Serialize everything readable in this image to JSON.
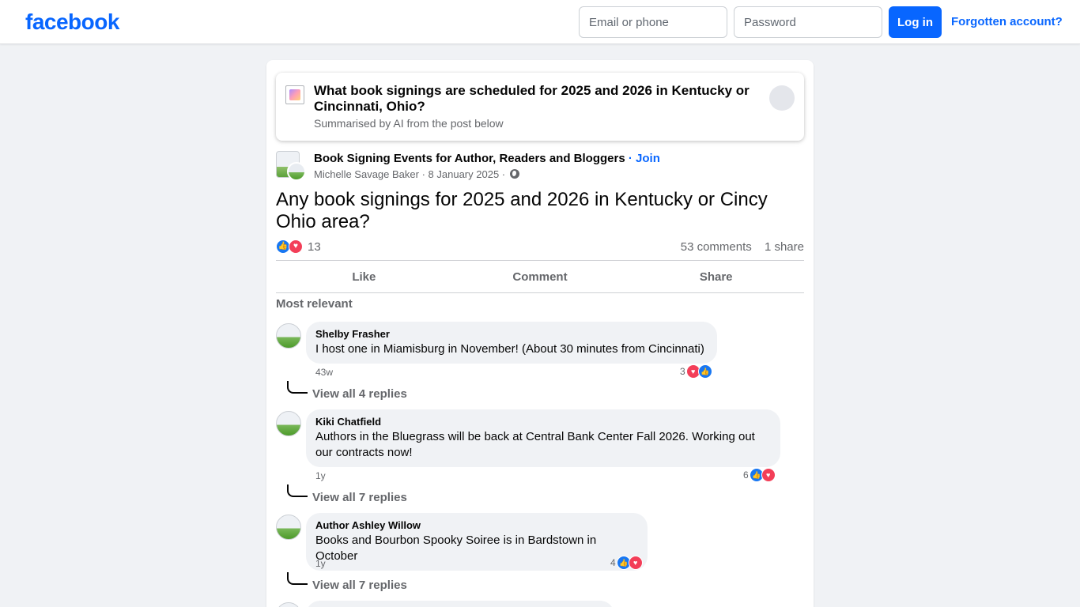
{
  "header": {
    "logo": "facebook",
    "email_placeholder": "Email or phone",
    "password_placeholder": "Password",
    "login_label": "Log in",
    "forgot_label": "Forgotten account?"
  },
  "ai_summary": {
    "question": "What book signings are scheduled for 2025 and 2026 in Kentucky or Cincinnati, Ohio?",
    "subtitle": "Summarised by AI from the post below"
  },
  "post": {
    "group_name": "Book Signing Events for Author, Readers and Bloggers",
    "join_label": "Join",
    "author": "Michelle Savage Baker",
    "date": "8 January 2025",
    "text": "Any book signings for 2025 and 2026 in Kentucky or Cincy Ohio area?",
    "reaction_count": "13",
    "comments_count": "53 comments",
    "shares_count": "1 share"
  },
  "actions": {
    "like": "Like",
    "comment": "Comment",
    "share": "Share"
  },
  "sort_label": "Most relevant",
  "comments": [
    {
      "name": "Shelby Frasher",
      "text": "I host one in Miamisburg in November! (About 30 minutes from Cincinnati)",
      "time": "43w",
      "reactions": "3",
      "replies": "View all 4 replies"
    },
    {
      "name": "Kiki Chatfield",
      "text": "Authors in the Bluegrass will be back at Central Bank Center Fall 2026. Working out our contracts now!",
      "time": "1y",
      "reactions": "6",
      "replies": "View all 7 replies"
    },
    {
      "name": "Author Ashley Willow",
      "text": "Books and Bourbon Spooky Soiree is in Bardstown in October",
      "time": "1y",
      "reactions": "4",
      "replies": "View all 7 replies"
    }
  ],
  "colors": {
    "brand": "#0866ff",
    "like": "#1877f2",
    "love": "#f33e58",
    "background": "#f0f2f5"
  }
}
